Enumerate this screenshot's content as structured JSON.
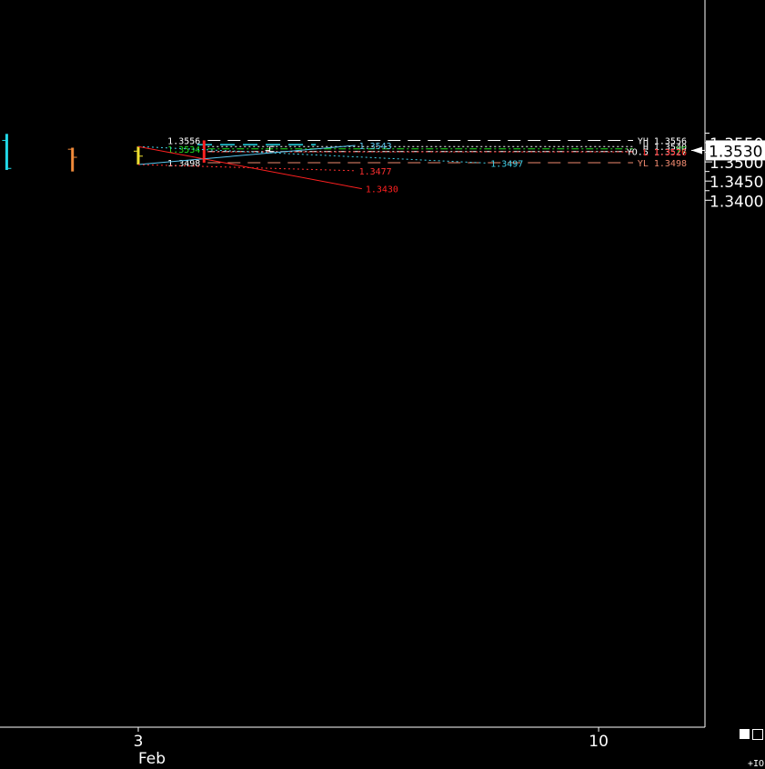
{
  "chart_data": {
    "type": "line",
    "title": "",
    "x_labels": [
      {
        "day": 3,
        "text": "3",
        "sub": "Feb"
      },
      {
        "day": 10,
        "text": "10"
      }
    ],
    "y_ticks": [
      "1.3550",
      "1.3500",
      "1.3450",
      "1.3400"
    ],
    "y_minor_ticks": [
      1.3575,
      1.3525,
      1.3475,
      1.3425
    ],
    "ylim": [
      1.3398,
      1.3574
    ],
    "current_price": {
      "value": 1.353,
      "label": "1.3530"
    },
    "corner_label": "+IO",
    "history_bars": [
      {
        "day": 1,
        "high": 1.3573,
        "low": 1.3479,
        "open": 1.3556,
        "close": 1.3483,
        "color": "#22d8e8"
      },
      {
        "day": 2,
        "high": 1.3537,
        "low": 1.3475,
        "open": 1.3533,
        "close": 1.3512,
        "color": "#f08a3a"
      },
      {
        "day": 3,
        "high": 1.354,
        "low": 1.3493,
        "open": 1.3528,
        "close": 1.3515,
        "color": "#f0e030"
      }
    ],
    "prior_day_bar": {
      "day": 4,
      "high": 1.3556,
      "low": 1.3498,
      "color": "#ff2020"
    },
    "current_bar": {
      "day": 5,
      "high": 1.354,
      "low": 1.3527,
      "last": 1.353,
      "color": "#ffffff"
    },
    "level_lines": [
      {
        "value": 1.3556,
        "label": "YH 1.3556",
        "color": "#ffffff",
        "dash": "dash"
      },
      {
        "value": 1.354,
        "label": "H 1.3540",
        "color": "#ffffff",
        "dash": "dot"
      },
      {
        "value": 1.3534,
        "label": "YC",
        "color": "#20e020",
        "dash": "dashdot"
      },
      {
        "value": 1.3527,
        "label": "YO.5 1.3527",
        "color": "#ffffff",
        "dash": "dashdot"
      },
      {
        "value": 1.3526,
        "label": "L 1.3526",
        "color": "#ff2020",
        "dash": "dot"
      },
      {
        "value": 1.3498,
        "label": "YL 1.3498",
        "color": "#f08a70",
        "dash": "dash"
      }
    ],
    "prev_labels": [
      {
        "value": 1.3556,
        "text": "1.3556",
        "color": "#ffffff"
      },
      {
        "value": 1.3534,
        "text": "1.3534",
        "color": "#20e020"
      },
      {
        "value": 1.3498,
        "text": "1.3498",
        "color": "#ffffff"
      }
    ],
    "projections": [
      {
        "from": {
          "day": 3,
          "value": 1.3493
        },
        "to": {
          "day": 6.3,
          "value": 1.3543
        },
        "label": "1.3543",
        "color": "#5ac8f0",
        "dash": "solid"
      },
      {
        "from": {
          "day": 3,
          "value": 1.354
        },
        "to": {
          "day": 8.3,
          "value": 1.3497
        },
        "label": "1.3497",
        "color": "#40d0e8",
        "dash": "dot"
      },
      {
        "from": {
          "day": 3,
          "value": 1.3493
        },
        "to": {
          "day": 6.3,
          "value": 1.3477
        },
        "label": "1.3477",
        "color": "#ff3030",
        "dash": "dot"
      },
      {
        "from": {
          "day": 3,
          "value": 1.354
        },
        "to": {
          "day": 6.4,
          "value": 1.343
        },
        "label": "1.3430",
        "color": "#ff2020",
        "dash": "solid"
      }
    ],
    "reference_segment": {
      "from_day": 3.9,
      "to_day": 5.7,
      "value": 1.3545,
      "color": "#22d8e8"
    }
  }
}
